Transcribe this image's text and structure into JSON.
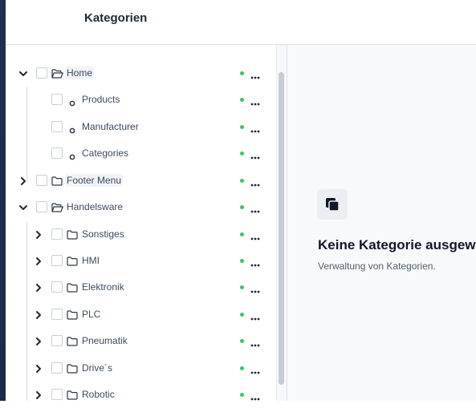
{
  "header": {
    "title": "Kategorien"
  },
  "tree": {
    "items": [
      {
        "label": "Home",
        "level": 0,
        "toggle": "expanded",
        "icon": "folder-open-icon",
        "highlight": true
      },
      {
        "label": "Products",
        "level": 1,
        "toggle": "none",
        "icon": "circle-icon",
        "highlight": false
      },
      {
        "label": "Manufacturer",
        "level": 1,
        "toggle": "none",
        "icon": "circle-icon",
        "highlight": false
      },
      {
        "label": "Categories",
        "level": 1,
        "toggle": "none",
        "icon": "circle-icon",
        "highlight": false
      },
      {
        "label": "Footer Menu",
        "level": 0,
        "toggle": "collapsed",
        "icon": "folder-icon",
        "highlight": true
      },
      {
        "label": "Handelsware",
        "level": 0,
        "toggle": "expanded",
        "icon": "folder-open-icon",
        "highlight": false
      },
      {
        "label": "Sonstiges",
        "level": 1,
        "toggle": "collapsed",
        "icon": "folder-icon",
        "highlight": false
      },
      {
        "label": "HMI",
        "level": 1,
        "toggle": "collapsed",
        "icon": "folder-icon",
        "highlight": false
      },
      {
        "label": "Elektronik",
        "level": 1,
        "toggle": "collapsed",
        "icon": "folder-icon",
        "highlight": false
      },
      {
        "label": "PLC",
        "level": 1,
        "toggle": "collapsed",
        "icon": "folder-icon",
        "highlight": false
      },
      {
        "label": "Pneumatik",
        "level": 1,
        "toggle": "collapsed",
        "icon": "folder-icon",
        "highlight": false
      },
      {
        "label": "Drive´s",
        "level": 1,
        "toggle": "collapsed",
        "icon": "folder-icon",
        "highlight": false
      },
      {
        "label": "Robotic",
        "level": 1,
        "toggle": "collapsed",
        "icon": "folder-icon",
        "highlight": false
      }
    ],
    "status_color": "#3cc461",
    "more_icon": "more-horizontal-icon"
  },
  "empty_state": {
    "icon": "copy-icon",
    "title": "Keine Kategorie ausgewä",
    "description": "Verwaltung von Kategorien."
  },
  "colors": {
    "sidebar_strip": "#1e2f4f",
    "status_active": "#3cc461"
  }
}
